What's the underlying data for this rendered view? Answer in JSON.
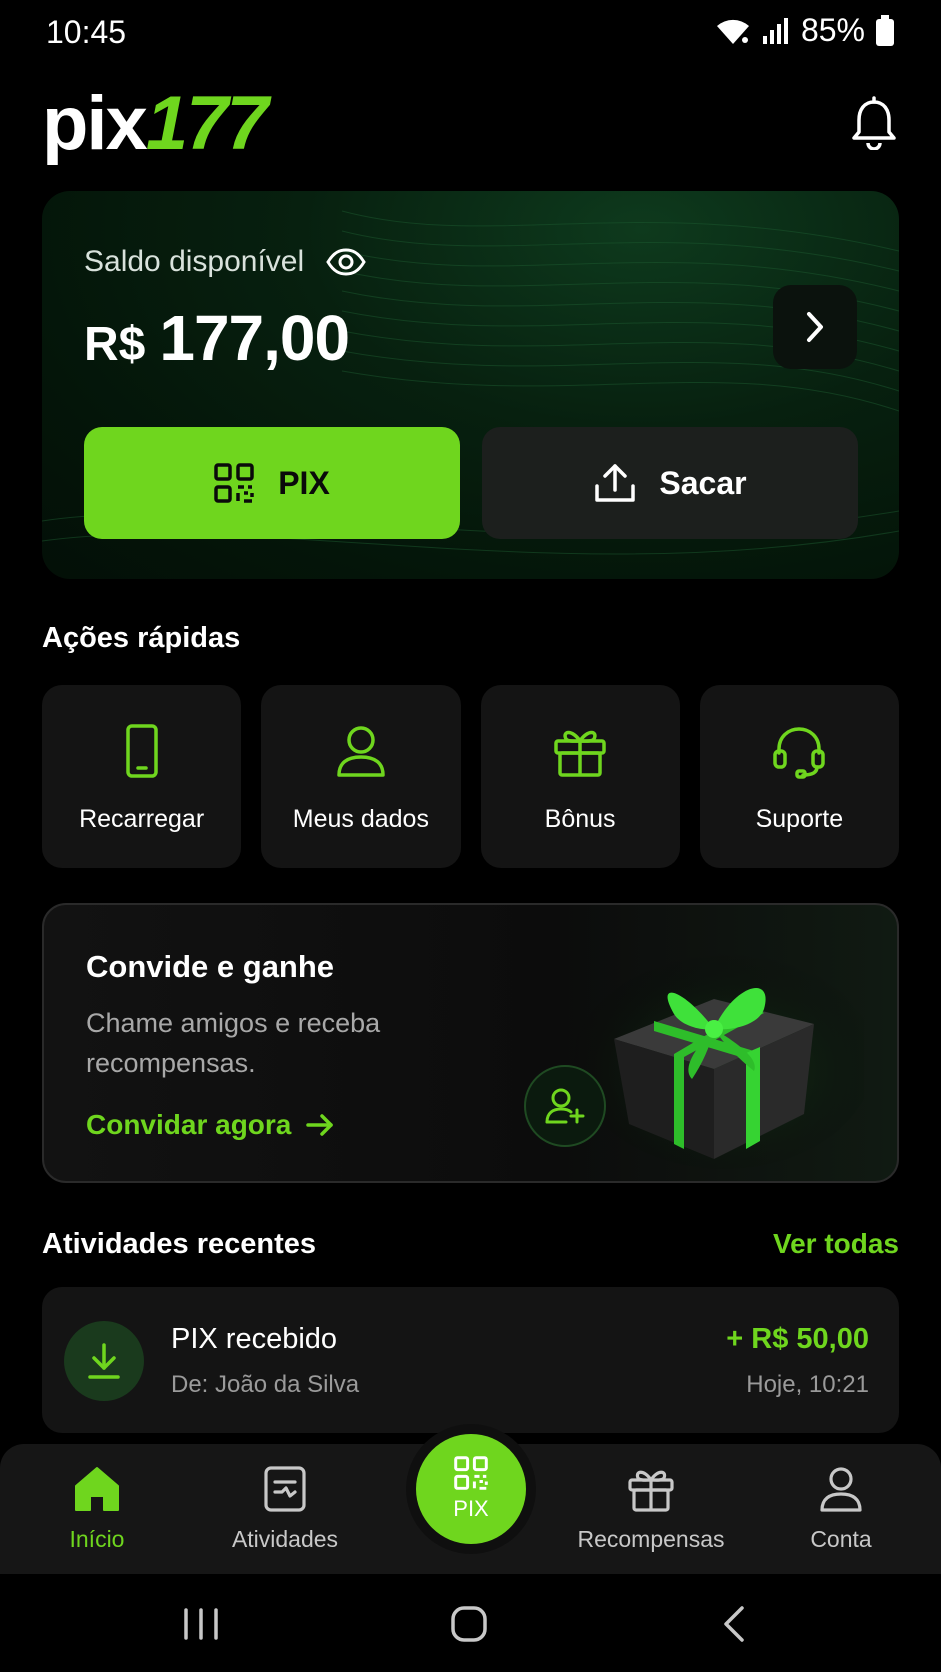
{
  "status_bar": {
    "time": "10:45",
    "battery": "85%"
  },
  "header": {
    "logo_text": "pix",
    "logo_number": "177"
  },
  "balance": {
    "label": "Saldo disponível",
    "currency": "R$",
    "amount": "177,00",
    "pix_button": "PIX",
    "withdraw_button": "Sacar"
  },
  "quick_actions": {
    "title": "Ações rápidas",
    "items": [
      {
        "label": "Recarregar",
        "icon": "phone-icon"
      },
      {
        "label": "Meus dados",
        "icon": "user-icon"
      },
      {
        "label": "Bônus",
        "icon": "gift-icon"
      },
      {
        "label": "Suporte",
        "icon": "headset-icon"
      }
    ]
  },
  "invite": {
    "title": "Convide e ganhe",
    "description": "Chame amigos e receba recompensas.",
    "cta": "Convidar agora"
  },
  "recent": {
    "title": "Atividades recentes",
    "see_all": "Ver todas",
    "items": [
      {
        "title": "PIX recebido",
        "subtitle": "De: João da Silva",
        "amount": "+ R$ 50,00",
        "time": "Hoje, 10:21"
      }
    ]
  },
  "bottom_nav": {
    "items": [
      {
        "label": "Início",
        "icon": "home-icon",
        "active": true
      },
      {
        "label": "Atividades",
        "icon": "document-icon",
        "active": false
      },
      {
        "label": "PIX",
        "icon": "qr-icon",
        "active": false
      },
      {
        "label": "Recompensas",
        "icon": "gift-icon",
        "active": false
      },
      {
        "label": "Conta",
        "icon": "user-icon",
        "active": false
      }
    ]
  },
  "colors": {
    "accent": "#6fd61e",
    "background": "#000000",
    "card": "#141414"
  }
}
